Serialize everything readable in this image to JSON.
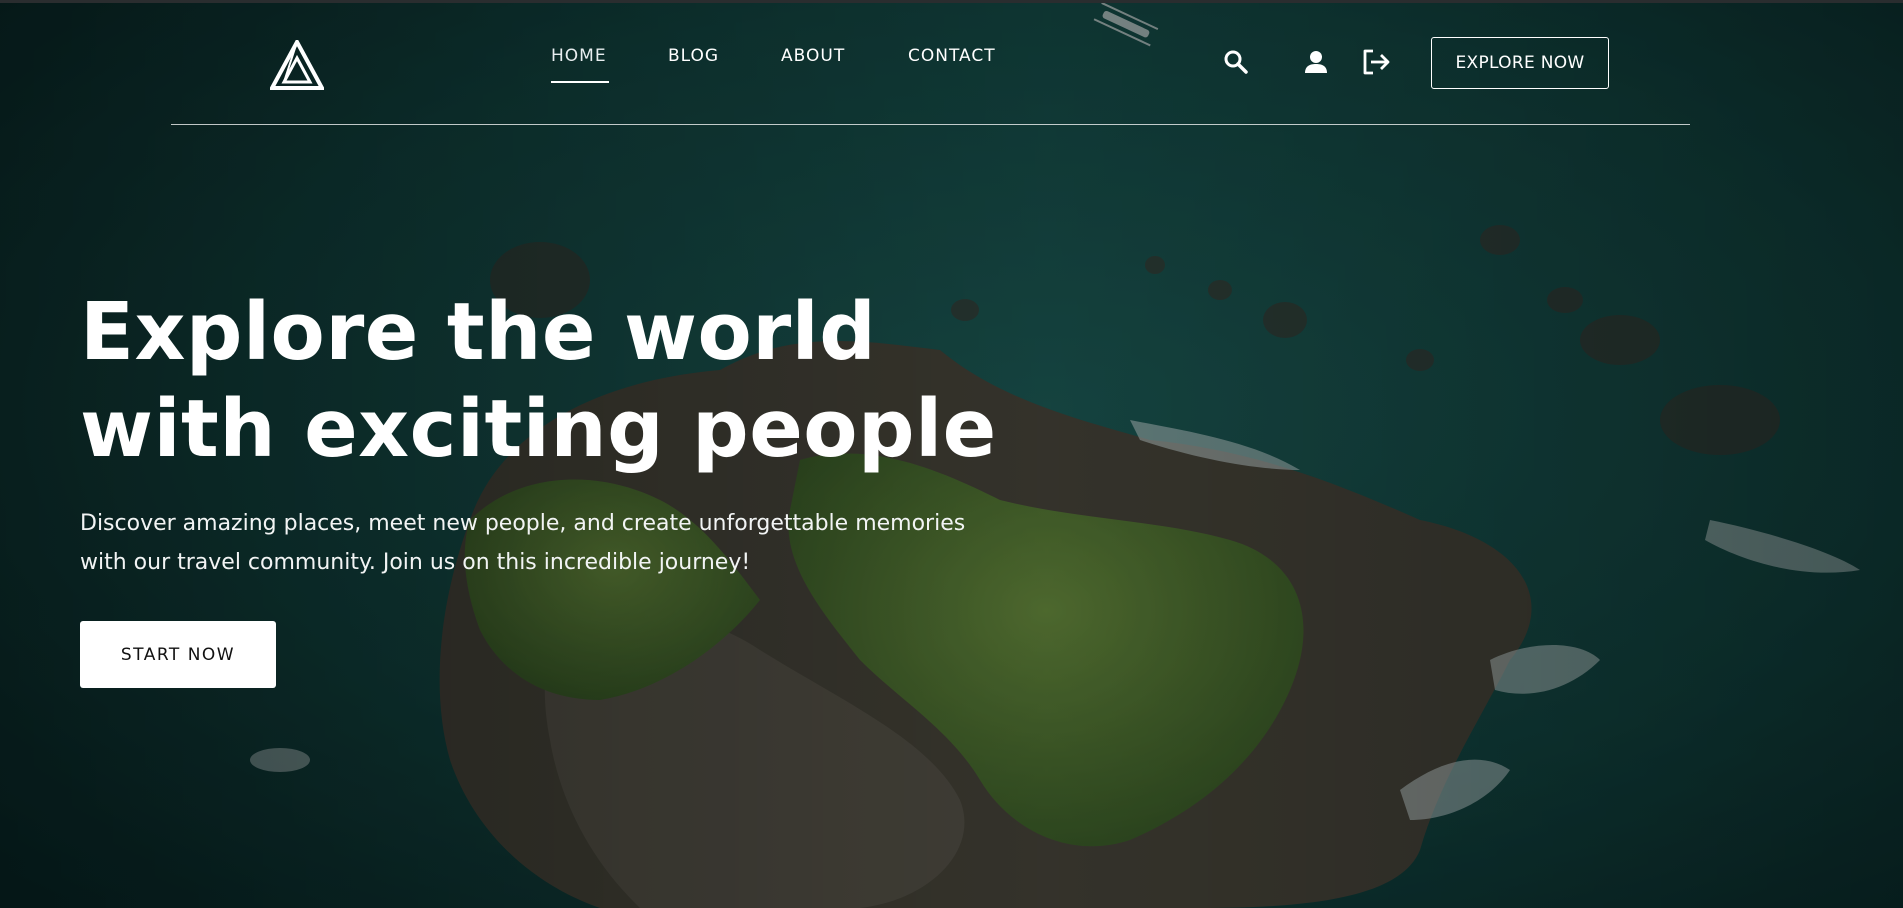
{
  "nav": {
    "items": [
      {
        "label": "HOME",
        "active": true
      },
      {
        "label": "BLOG",
        "active": false
      },
      {
        "label": "ABOUT",
        "active": false
      },
      {
        "label": "CONTACT",
        "active": false
      }
    ],
    "icons": [
      "search-icon",
      "user-icon",
      "logout-icon"
    ],
    "cta_label": "EXPLORE NOW"
  },
  "hero": {
    "headline_line1": "Explore the world",
    "headline_line2": "with exciting people",
    "subtext_line1": "Discover amazing places, meet new people, and create unforgettable memories",
    "subtext_line2": "with our travel community. Join us on this incredible journey!",
    "button_label": "START NOW"
  },
  "colors": {
    "overlay": "#0c2b2a",
    "text": "#ffffff",
    "button_bg": "#ffffff",
    "button_text": "#111111"
  }
}
